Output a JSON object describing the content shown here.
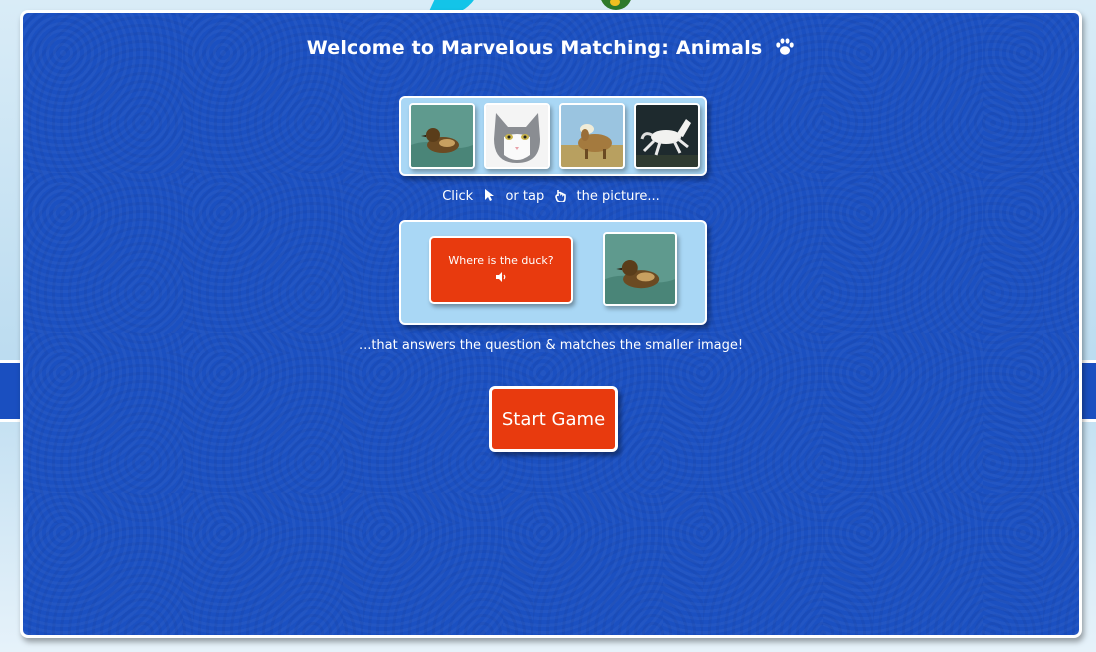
{
  "title": "Welcome to Marvelous Matching: Animals",
  "title_icon": "paw-icon",
  "example_tiles": [
    {
      "animal": "duck"
    },
    {
      "animal": "cat"
    },
    {
      "animal": "sheep"
    },
    {
      "animal": "horse"
    }
  ],
  "instructions": {
    "line1_prefix": "Click",
    "line1_middle": "or tap",
    "line1_suffix": "the picture...",
    "line2": "...that answers the question & matches the smaller image!"
  },
  "question_card": {
    "text": "Where is the duck?",
    "icon": "speaker-icon"
  },
  "start_button": {
    "label": "Start Game"
  },
  "colors": {
    "modal_bg": "#1b50c1",
    "accent": "#e83a0e",
    "panel": "#a9d7f5"
  }
}
